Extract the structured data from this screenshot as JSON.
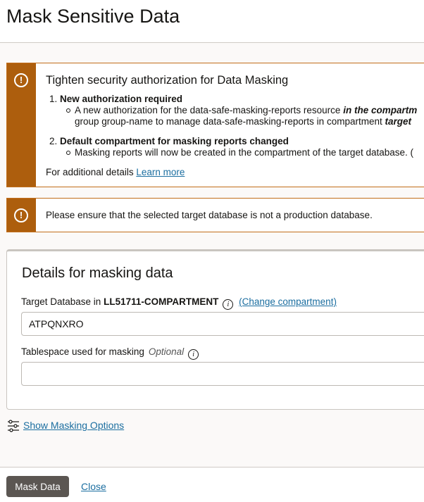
{
  "page": {
    "title": "Mask Sensitive Data"
  },
  "banner_auth": {
    "title": "Tighten security authorization for Data Masking",
    "item1_num": "1.",
    "item1_heading": "New authorization required",
    "item1_line1_a": "A new authorization for the data-safe-masking-reports resource ",
    "item1_line1_b": "in the compartm",
    "item1_line2_a": "group group-name to manage data-safe-masking-reports in compartment ",
    "item1_line2_b": "target",
    "item2_num": "2.",
    "item2_heading": "Default compartment for masking reports changed",
    "item2_line1": "Masking reports will now be created in the compartment of the target database. (",
    "footer_text": "For additional details ",
    "learn_more": "Learn more"
  },
  "banner_warning": {
    "text": "Please ensure that the selected target database is not a production database."
  },
  "details": {
    "title": "Details for masking data",
    "target_label_prefix": "Target Database in ",
    "compartment": "LL51711-COMPARTMENT",
    "change_compartment": "(Change compartment)",
    "target_value": "ATPQNXRO",
    "tablespace_label": "Tablespace used for masking",
    "tablespace_optional": "Optional",
    "tablespace_value": ""
  },
  "masking_options": {
    "label": "Show Masking Options"
  },
  "footer": {
    "mask_button": "Mask Data",
    "close_link": "Close"
  },
  "icons": {
    "alert": "alert-circle-icon",
    "info": "info-icon",
    "options": "sliders-icon"
  },
  "colors": {
    "warning": "#ad5e0d",
    "link": "#1b6ea0",
    "primary_button": "#5b5652"
  }
}
